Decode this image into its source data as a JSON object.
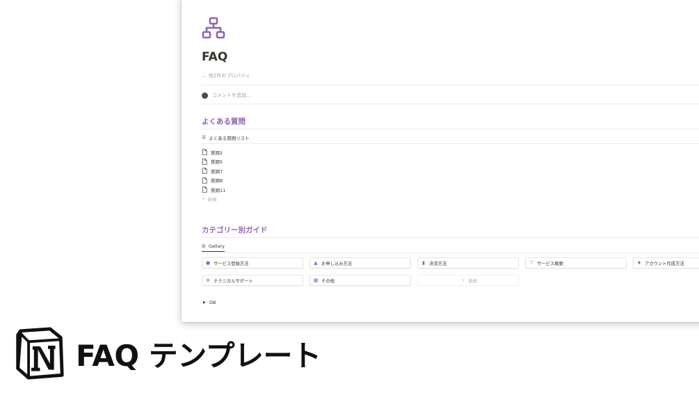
{
  "colors": {
    "accent": "#9065b0",
    "text": "#37352f",
    "muted": "#a5a29c"
  },
  "page": {
    "icon": "sitemap-icon",
    "title": "FAQ",
    "properties_toggle": "他2件のプロパティ",
    "comment_placeholder": "コメントを追加..."
  },
  "faq_section": {
    "heading": "よくある質問",
    "view_tab": "よくある質問リスト",
    "items": [
      "質問2",
      "質問5",
      "質問7",
      "質問8",
      "質問11"
    ],
    "new_label": "新規"
  },
  "guide_section": {
    "heading": "カテゴリー別ガイド",
    "view_tab": "Gallary",
    "cards": [
      {
        "label": "サービス登録方法",
        "icon": "chat-bubbles-icon"
      },
      {
        "label": "お申し込み方法",
        "icon": "cart-icon"
      },
      {
        "label": "決済方法",
        "icon": "clipboard-icon"
      },
      {
        "label": "サービス概要",
        "icon": "signpost-icon"
      },
      {
        "label": "アカウント作成方法",
        "icon": "pin-icon"
      },
      {
        "label": "テクニカルサポート",
        "icon": "globe-icon"
      },
      {
        "label": "その他",
        "icon": "calendar-icon"
      }
    ],
    "new_label": "新規"
  },
  "toggle_block": {
    "label": "DB"
  },
  "brand": {
    "title": "FAQ テンプレート",
    "logo": "notion-logo-icon"
  }
}
